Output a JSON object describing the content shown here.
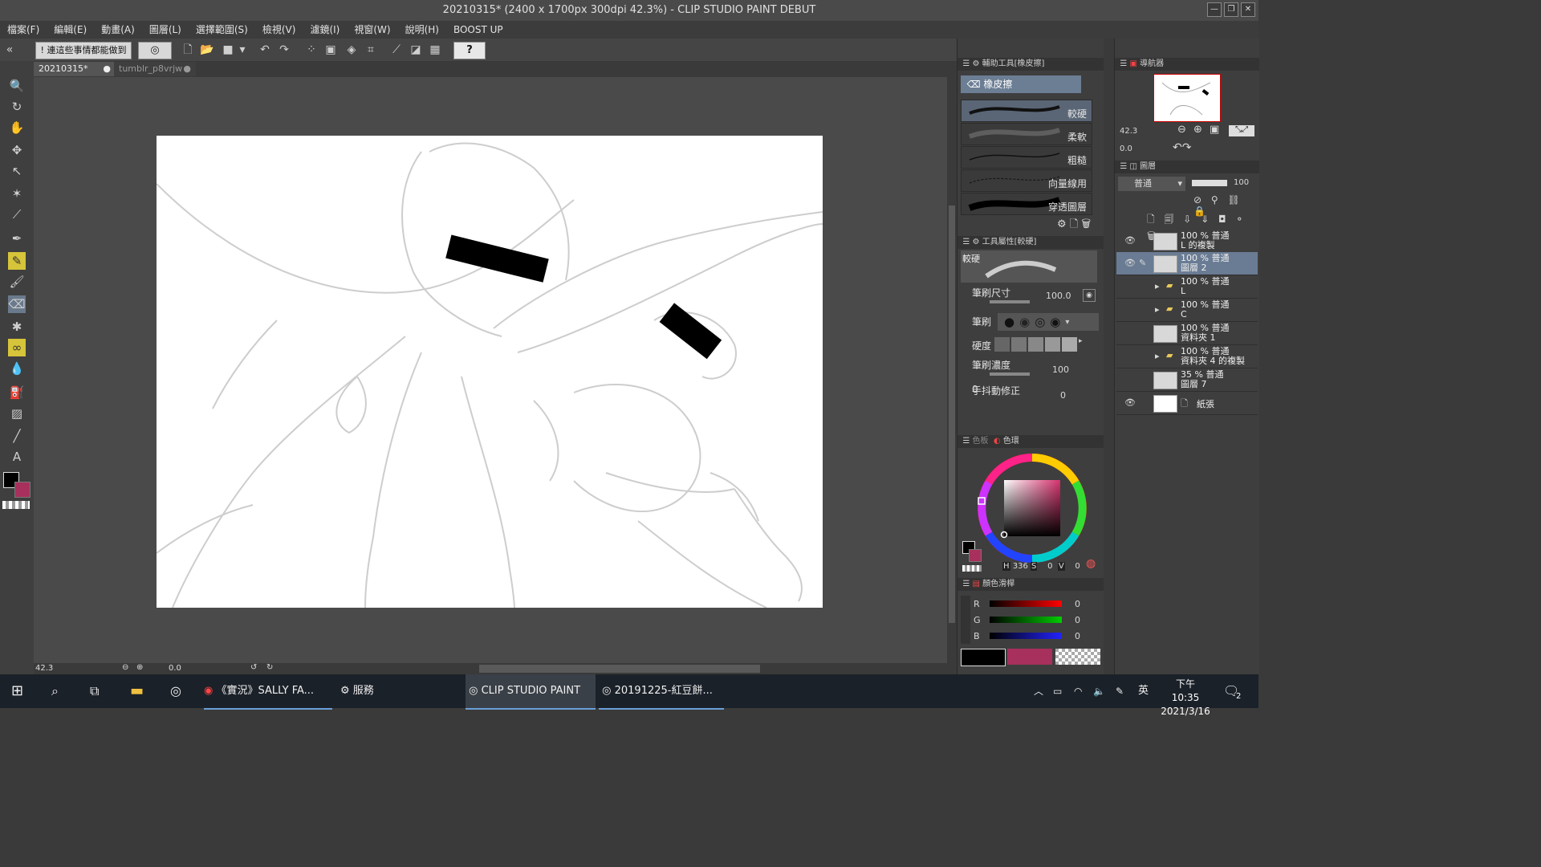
{
  "window": {
    "title": "20210315* (2400 x 1700px 300dpi 42.3%)  - CLIP STUDIO PAINT DEBUT",
    "controls": [
      "—",
      "❐",
      "✕"
    ]
  },
  "menu": [
    "檔案(F)",
    "編輯(E)",
    "動畫(A)",
    "圖層(L)",
    "選擇範圍(S)",
    "檢視(V)",
    "濾鏡(I)",
    "視窗(W)",
    "說明(H)",
    "BOOST UP"
  ],
  "toolbar": {
    "notice": "連這些事情都能做到",
    "help": "?"
  },
  "tabs": [
    {
      "label": "20210315*"
    },
    {
      "label": "tumblr_p8vrjw"
    }
  ],
  "status": {
    "zoom": "42.3",
    "angle": "0.0"
  },
  "subtool_panel": {
    "header": "輔助工具[橡皮擦]",
    "group": "橡皮擦",
    "items": [
      "較硬",
      "柔軟",
      "粗糙",
      "向量線用",
      "穿透圖層"
    ]
  },
  "tool_property": {
    "header": "工具屬性[較硬]",
    "preset": "較硬",
    "brush_size_label": "筆刷尺寸",
    "brush_size": "100.0",
    "tip_label": "筆刷",
    "hardness_label": "硬度",
    "density_label": "筆刷濃度",
    "density": "100",
    "stabilization_label": "手抖動修正",
    "stabilization": "0"
  },
  "color_panel": {
    "tabs": [
      "色板",
      "色環"
    ],
    "h": "336",
    "s": "0",
    "v": "0",
    "h_label": "H",
    "s_label": "S",
    "v_label": "V"
  },
  "color_slider": {
    "header": "顏色滑桿",
    "rows": [
      {
        "label": "R",
        "value": "0"
      },
      {
        "label": "G",
        "value": "0"
      },
      {
        "label": "B",
        "value": "0"
      }
    ]
  },
  "navigator": {
    "header": "導航器",
    "zoom": "42.3",
    "angle": "0.0"
  },
  "layer_panel": {
    "header": "圖層",
    "blend_mode": "普通",
    "opacity": "100",
    "layers": [
      {
        "line1": "100 % 普通",
        "line2": "L 的複製",
        "visible": true
      },
      {
        "line1": "100 % 普通",
        "line2": "圖層 2",
        "visible": true
      },
      {
        "line1": "100 % 普通",
        "line2": "L",
        "visible": false
      },
      {
        "line1": "100 % 普通",
        "line2": "C",
        "visible": false
      },
      {
        "line1": "100 % 普通",
        "line2": "資料夾 1",
        "visible": false
      },
      {
        "line1": "100 % 普通",
        "line2": "資料夾 4 的複製",
        "visible": false
      },
      {
        "line1": "35 % 普通",
        "line2": "圖層 7",
        "visible": false
      },
      {
        "line1": "紙張",
        "line2": "",
        "visible": true
      }
    ]
  },
  "taskbar": {
    "apps": [
      {
        "label": "《實況》SALLY FA..."
      },
      {
        "label": "服務"
      },
      {
        "label": "CLIP STUDIO PAINT"
      },
      {
        "label": "20191225-紅豆餅..."
      }
    ],
    "ime": "英",
    "time": "下午 10:35",
    "date": "2021/3/16",
    "notifications": "2"
  },
  "colors": {
    "main": "#000000",
    "sub": "#a8305c"
  }
}
